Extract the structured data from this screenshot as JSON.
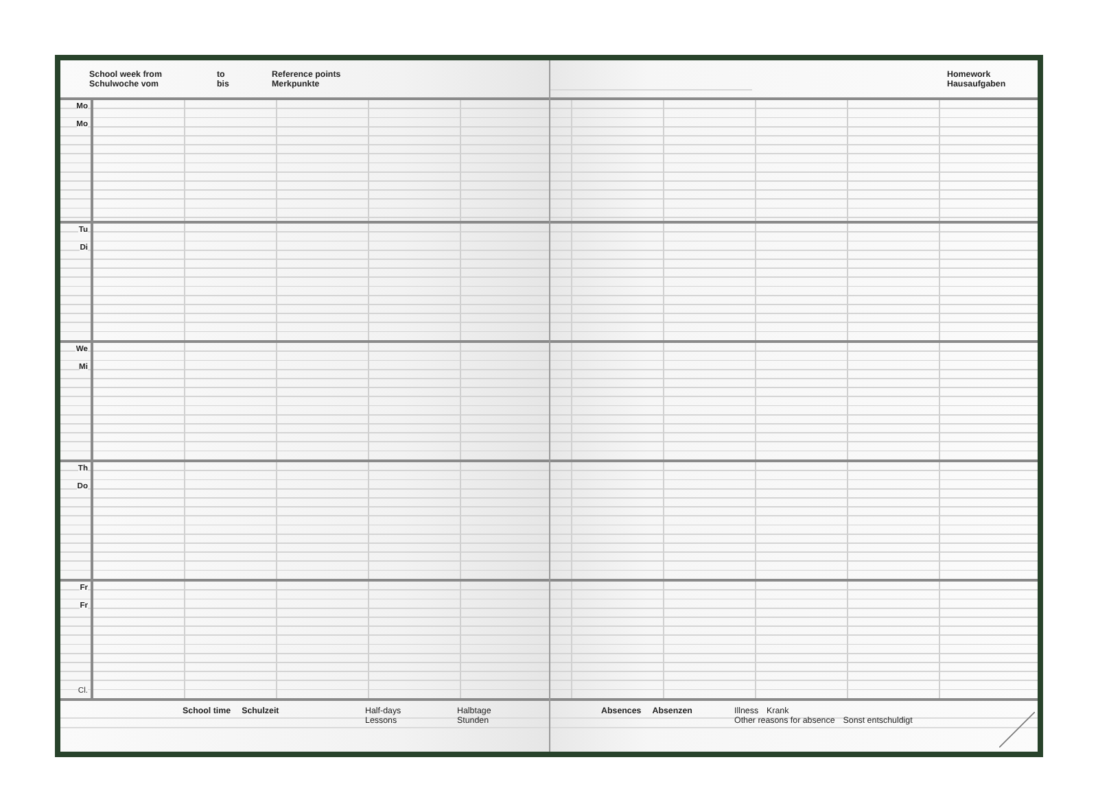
{
  "left_page": {
    "header": {
      "week_from": {
        "en": "School week from",
        "de": "Schulwoche vom"
      },
      "to": {
        "en": "to",
        "de": "bis"
      },
      "reference_points": {
        "en": "Reference points",
        "de": "Merkpunkte"
      }
    },
    "days": [
      {
        "en": "Mo",
        "de": "Mo"
      },
      {
        "en": "Tu",
        "de": "Di"
      },
      {
        "en": "We",
        "de": "Mi"
      },
      {
        "en": "Th",
        "de": "Do"
      },
      {
        "en": "Fr",
        "de": "Fr"
      }
    ],
    "class_label": "Cl.",
    "footer": {
      "school_time": {
        "en": "School time",
        "de": "Schulzeit"
      },
      "half_days": {
        "en": "Half-days",
        "de": "Halbtage"
      },
      "lessons": {
        "en": "Lessons",
        "de": "Stunden"
      }
    }
  },
  "right_page": {
    "header": {
      "homework": {
        "en": "Homework",
        "de": "Hausaufgaben"
      }
    },
    "footer": {
      "absences": {
        "en": "Absences",
        "de": "Absenzen"
      },
      "illness": {
        "en": "Illness",
        "de": "Krank"
      },
      "other_reasons": {
        "en": "Other reasons for absence",
        "de": "Sonst entschuldigt"
      }
    }
  }
}
